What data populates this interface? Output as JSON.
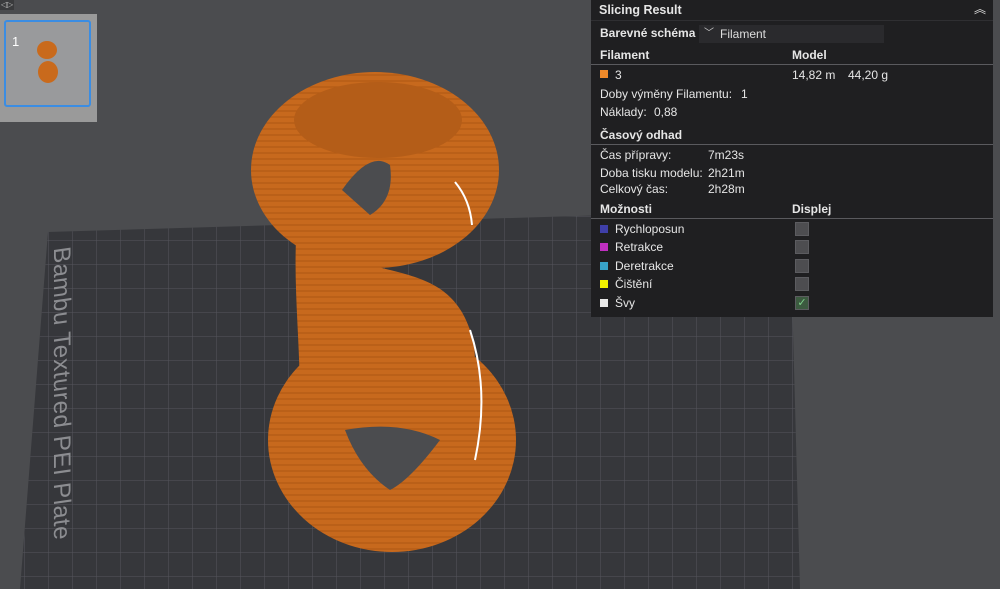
{
  "viewport": {
    "plate_label": "Bambu Textured PEI Plate",
    "plate_number": "1",
    "model_color": "#c96a1c",
    "bed_color": "#38393e"
  },
  "panel": {
    "title": "Slicing Result",
    "color_scheme_label": "Barevné schéma",
    "color_scheme_value": "Filament",
    "col_filament": "Filament",
    "col_model": "Model",
    "filament_row": {
      "id": "3",
      "length": "14,82 m",
      "weight": "44,20 g",
      "color": "#f08a2a"
    },
    "filament_changes_label": "Doby výměny Filamentu:",
    "filament_changes_value": "1",
    "cost_label": "Náklady:",
    "cost_value": "0,88",
    "time_section": "Časový odhad",
    "prep_label": "Čas přípravy:",
    "prep_value": "7m23s",
    "print_label": "Doba tisku modelu:",
    "print_value": "2h21m",
    "total_label": "Celkový čas:",
    "total_value": "2h28m",
    "col_options": "Možnosti",
    "col_display": "Displej",
    "options": [
      {
        "label": "Rychloposun",
        "color": "#3f3fa8",
        "checked": false
      },
      {
        "label": "Retrakce",
        "color": "#c02fc0",
        "checked": false
      },
      {
        "label": "Deretrakce",
        "color": "#38a3c8",
        "checked": false
      },
      {
        "label": "Čištění",
        "color": "#f2f200",
        "checked": false
      },
      {
        "label": "Švy",
        "color": "#e8e8e8",
        "checked": true
      }
    ]
  }
}
